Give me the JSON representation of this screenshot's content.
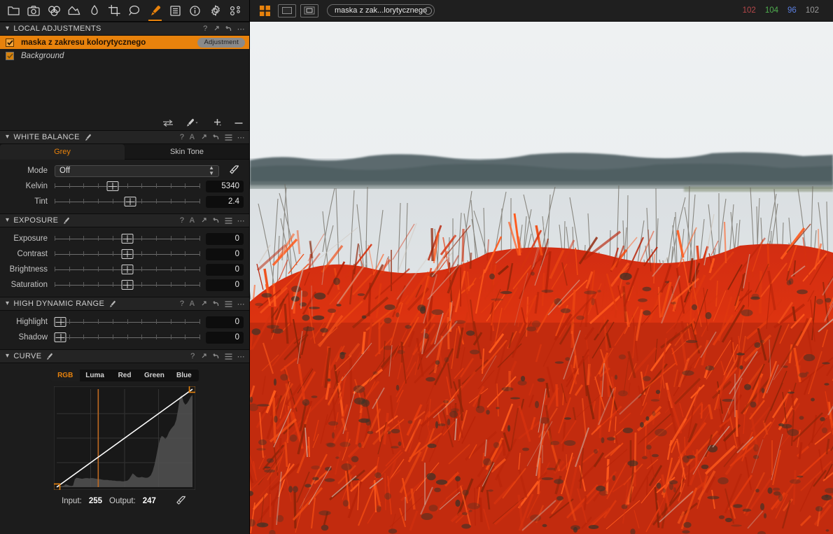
{
  "toolbar": {
    "items": [
      {
        "name": "folder-icon",
        "label": "Library",
        "active": false
      },
      {
        "name": "camera-icon",
        "label": "Capture",
        "active": false
      },
      {
        "name": "color-wheels-icon",
        "label": "Color",
        "active": false
      },
      {
        "name": "exposure-icon",
        "label": "Exposure",
        "active": false
      },
      {
        "name": "lens-icon",
        "label": "Lens",
        "active": false
      },
      {
        "name": "crop-icon",
        "label": "Crop",
        "active": false
      },
      {
        "name": "magnifier-icon",
        "label": "Details",
        "active": false
      },
      {
        "name": "brush-icon",
        "label": "Local Adjustments",
        "active": true
      },
      {
        "name": "list-icon",
        "label": "Metadata",
        "active": false
      },
      {
        "name": "info-icon",
        "label": "Info",
        "active": false
      },
      {
        "name": "gear-icon",
        "label": "Adjustments",
        "active": false
      },
      {
        "name": "batch-icon",
        "label": "Batch",
        "active": false
      }
    ]
  },
  "local_adjustments": {
    "title": "LOCAL ADJUSTMENTS",
    "header_icons": [
      "help-icon",
      "expand-icon",
      "reset-icon",
      "ellipsis-icon"
    ],
    "layers": [
      {
        "name": "maska z zakresu kolorytycznego",
        "badge": "Adjustment",
        "selected": true,
        "checked": true,
        "italic": false
      },
      {
        "name": "Background",
        "badge": "",
        "selected": false,
        "checked": true,
        "italic": true
      }
    ],
    "tools": [
      "swap-arrows-icon",
      "brush-dropdown-icon",
      "add-layer-icon",
      "remove-layer-icon"
    ]
  },
  "white_balance": {
    "title": "WHITE BALANCE",
    "header_icons": [
      "help-icon",
      "auto-icon",
      "expand-icon",
      "reset-icon",
      "presets-icon",
      "ellipsis-icon"
    ],
    "tabs": [
      {
        "label": "Grey",
        "active": true
      },
      {
        "label": "Skin Tone",
        "active": false
      }
    ],
    "mode": {
      "label": "Mode",
      "value": "Off"
    },
    "picker_icon": "eyedropper-icon",
    "sliders": [
      {
        "label": "Kelvin",
        "value": "5340",
        "pos": 40
      },
      {
        "label": "Tint",
        "value": "2.4",
        "pos": 52
      }
    ]
  },
  "exposure": {
    "title": "EXPOSURE",
    "header_icons": [
      "help-icon",
      "auto-icon",
      "expand-icon",
      "reset-icon",
      "presets-icon",
      "ellipsis-icon"
    ],
    "sliders": [
      {
        "label": "Exposure",
        "value": "0",
        "pos": 50
      },
      {
        "label": "Contrast",
        "value": "0",
        "pos": 50
      },
      {
        "label": "Brightness",
        "value": "0",
        "pos": 50
      },
      {
        "label": "Saturation",
        "value": "0",
        "pos": 50
      }
    ]
  },
  "hdr": {
    "title": "HIGH DYNAMIC RANGE",
    "header_icons": [
      "help-icon",
      "auto-icon",
      "expand-icon",
      "reset-icon",
      "presets-icon",
      "ellipsis-icon"
    ],
    "sliders": [
      {
        "label": "Highlight",
        "value": "0",
        "pos": 0
      },
      {
        "label": "Shadow",
        "value": "0",
        "pos": 0
      }
    ]
  },
  "curve": {
    "title": "CURVE",
    "header_icons": [
      "help-icon",
      "expand-icon",
      "reset-icon",
      "presets-icon",
      "ellipsis-icon"
    ],
    "tabs": [
      {
        "label": "RGB",
        "active": true
      },
      {
        "label": "Luma",
        "active": false
      },
      {
        "label": "Red",
        "active": false
      },
      {
        "label": "Green",
        "active": false
      },
      {
        "label": "Blue",
        "active": false
      }
    ],
    "input_label": "Input:",
    "input_value": "255",
    "output_label": "Output:",
    "output_value": "247",
    "picker_icon": "curve-eyedropper-icon"
  },
  "viewer": {
    "view_modes": [
      {
        "name": "grid-view-icon",
        "active": true
      },
      {
        "name": "single-view-icon",
        "active": false
      },
      {
        "name": "framed-view-icon",
        "active": false
      }
    ],
    "image_name": "maska z zak...lorytycznego",
    "readout": {
      "r": "102",
      "g": "104",
      "b": "96",
      "l": "102",
      "r_color": "#b5484a",
      "g_color": "#4fae4f",
      "b_color": "#5b7fe0",
      "l_color": "#9a9a9a"
    }
  },
  "chart_data": {
    "type": "area",
    "title": "RGB Tone Curve Histogram",
    "xlabel": "Input",
    "ylabel": "Output",
    "xlim": [
      0,
      255
    ],
    "ylim": [
      0,
      255
    ],
    "grid": true,
    "curve_points": [
      [
        0,
        0
      ],
      [
        255,
        255
      ]
    ],
    "cursor_input": 255,
    "cursor_output": 247,
    "marker_line_x": 78,
    "histogram": [
      2,
      2,
      3,
      3,
      4,
      8,
      6,
      4,
      3,
      4,
      22,
      26,
      25,
      24,
      23,
      24,
      25,
      25,
      24,
      25,
      25,
      24,
      23,
      22,
      22,
      21,
      20,
      20,
      20,
      19,
      19,
      18,
      18,
      17,
      17,
      17,
      16,
      16,
      17,
      18,
      22,
      30,
      38,
      34,
      29,
      27,
      27,
      28,
      27,
      26,
      26,
      28,
      33,
      44,
      62,
      86,
      112,
      132,
      142,
      139,
      133,
      140,
      152,
      160,
      166,
      172,
      186,
      214,
      248,
      255,
      236,
      228,
      232,
      240,
      250,
      255
    ]
  }
}
